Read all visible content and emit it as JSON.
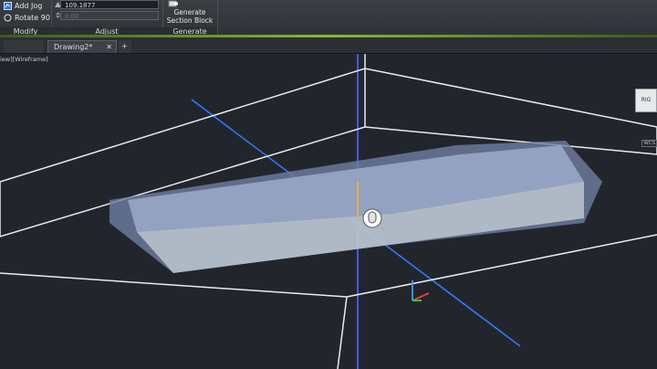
{
  "ribbon": {
    "modify": {
      "add_jog": "Add Jog",
      "rotate_90": "Rotate 90",
      "title": "Modify"
    },
    "adjust": {
      "value_field": "109.1877",
      "second_field": "0.00",
      "title": "Adjust"
    },
    "generate": {
      "button_label_line1": "Generate",
      "button_label_line2": "Section Block",
      "title": "Generate"
    }
  },
  "tabs": {
    "start_tab": "",
    "active_tab": "Drawing2*",
    "add_tab": "+"
  },
  "viewport": {
    "label": "iew][Wireframe]",
    "viewcube_label": "RIG",
    "wcs_label": "WCS"
  },
  "colors": {
    "accent_green": "#7fbf2a",
    "section_plane": "#2f7cff",
    "wireframe": "#ffffff"
  }
}
